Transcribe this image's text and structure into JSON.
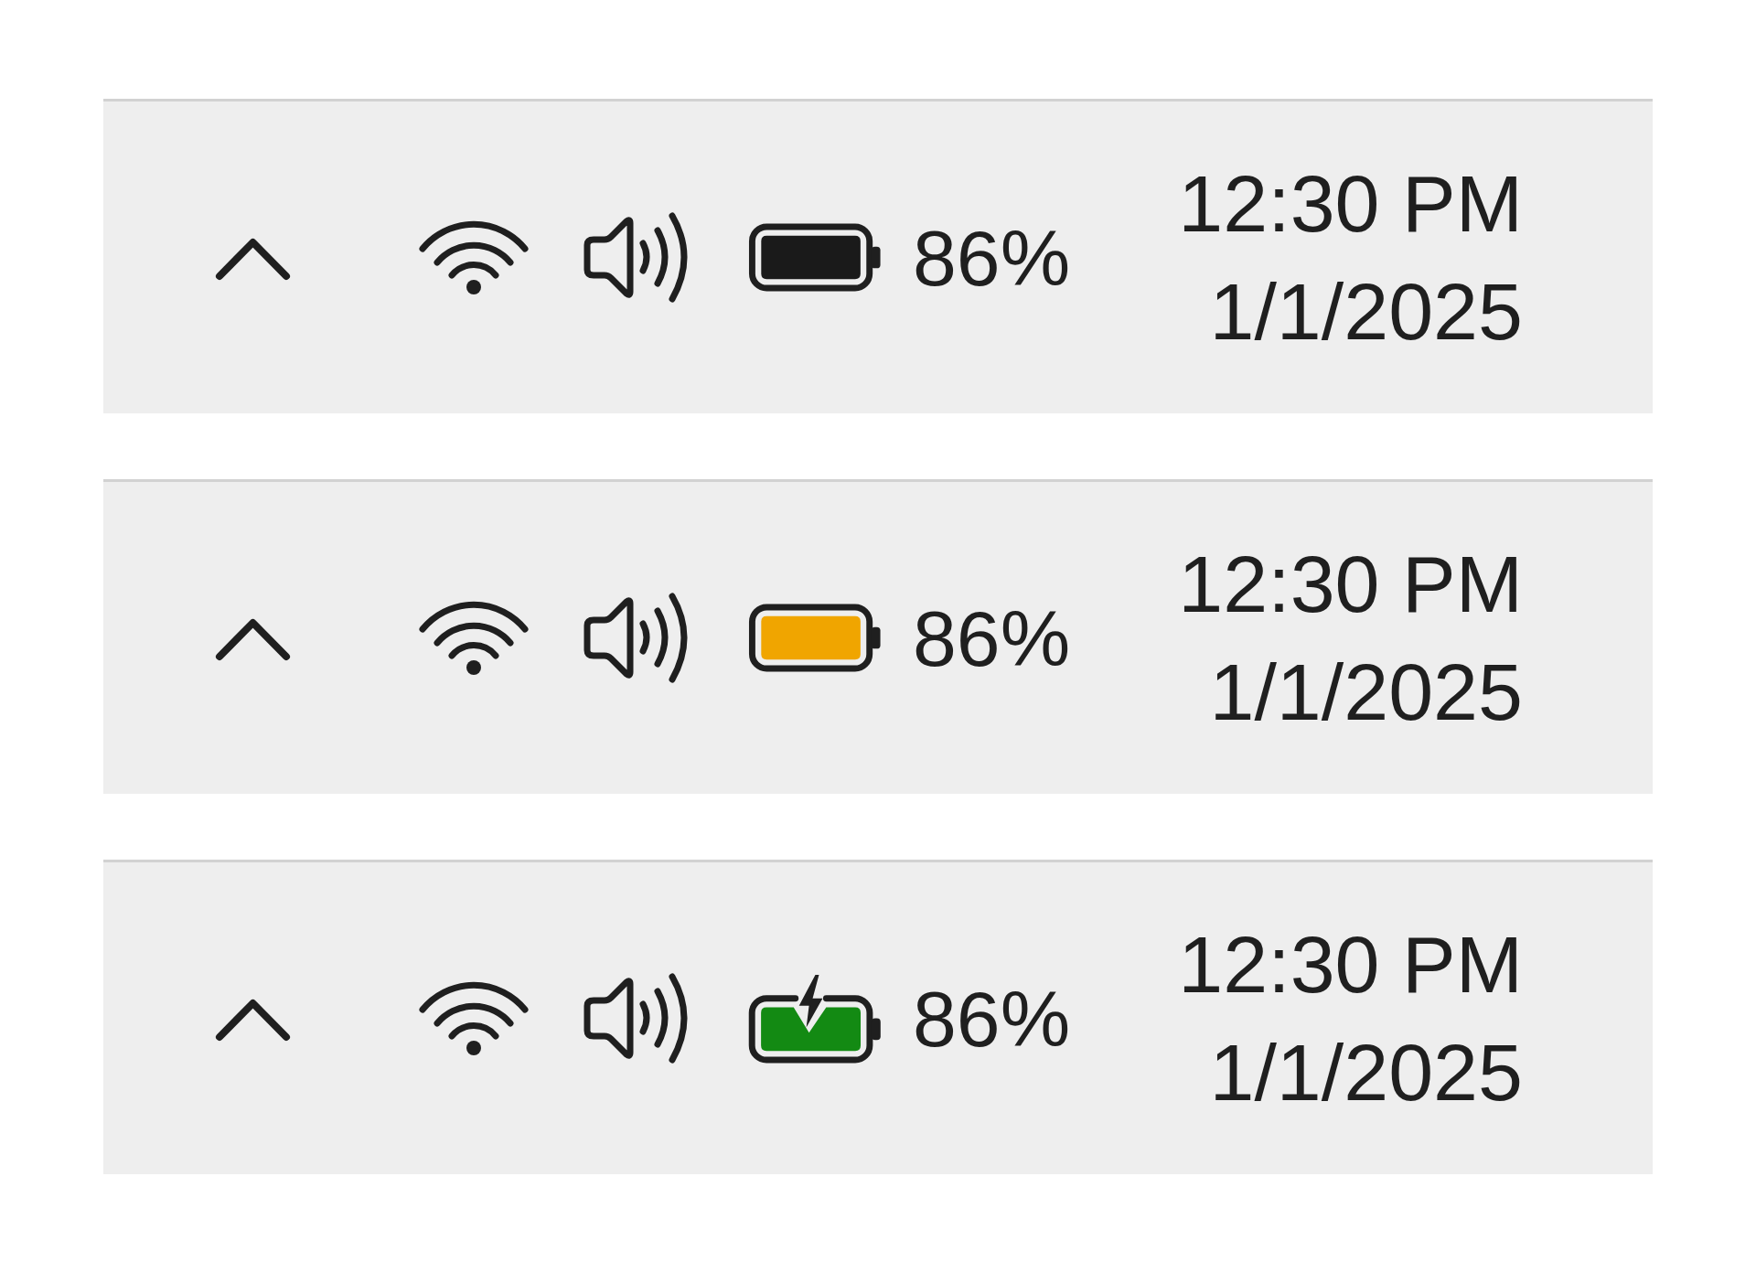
{
  "taskbar_trays": [
    {
      "battery": {
        "color": "#1a1a1a",
        "charging": false
      },
      "battery_percent": "86%",
      "time": "12:30 PM",
      "date": "1/1/2025"
    },
    {
      "battery": {
        "color": "#f0a500",
        "charging": false
      },
      "battery_percent": "86%",
      "time": "12:30 PM",
      "date": "1/1/2025"
    },
    {
      "battery": {
        "color": "#138a13",
        "charging": true
      },
      "battery_percent": "86%",
      "time": "12:30 PM",
      "date": "1/1/2025"
    }
  ]
}
